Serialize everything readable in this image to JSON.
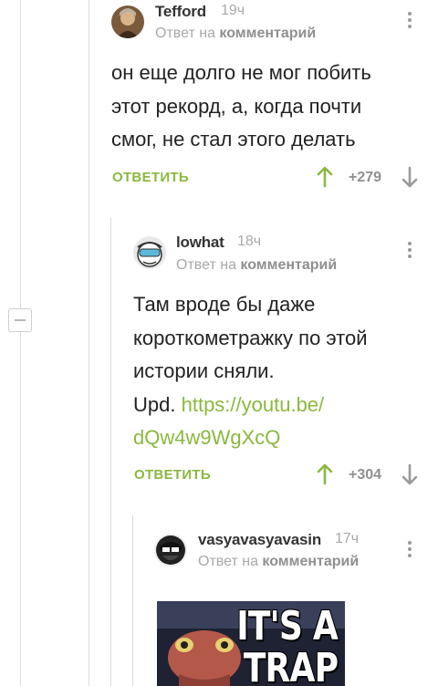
{
  "reply_to_prefix": "Ответ на",
  "reply_to_target": "комментарий",
  "reply_label": "ОТВЕТИТЬ",
  "comments": [
    {
      "author": "Tefford",
      "time": "19ч",
      "text": "он еще долго не мог побить этот рекорд, а, когда почти смог, не стал этого делать",
      "rating": "+279"
    },
    {
      "author": "lowhat",
      "time": "18ч",
      "text_lines": [
        "Там вроде бы даже",
        "короткометражку по этой",
        "истории сняли."
      ],
      "upd_prefix": "Upd.",
      "link_line1": "https://youtu.be/",
      "link_line2": "dQw4w9WgXcQ",
      "rating": "+304"
    },
    {
      "author": "vasyavasyavasin",
      "time": "17ч",
      "meme_text": [
        "IT'S A",
        "TRAP"
      ]
    }
  ],
  "colors": {
    "accent_green": "#8ab83f",
    "meta_gray": "#a8a8a8",
    "line_gray": "#dcdcdc"
  },
  "icons": [
    "more-vertical-icon",
    "arrow-up-icon",
    "arrow-down-icon",
    "collapse-minus-icon"
  ]
}
